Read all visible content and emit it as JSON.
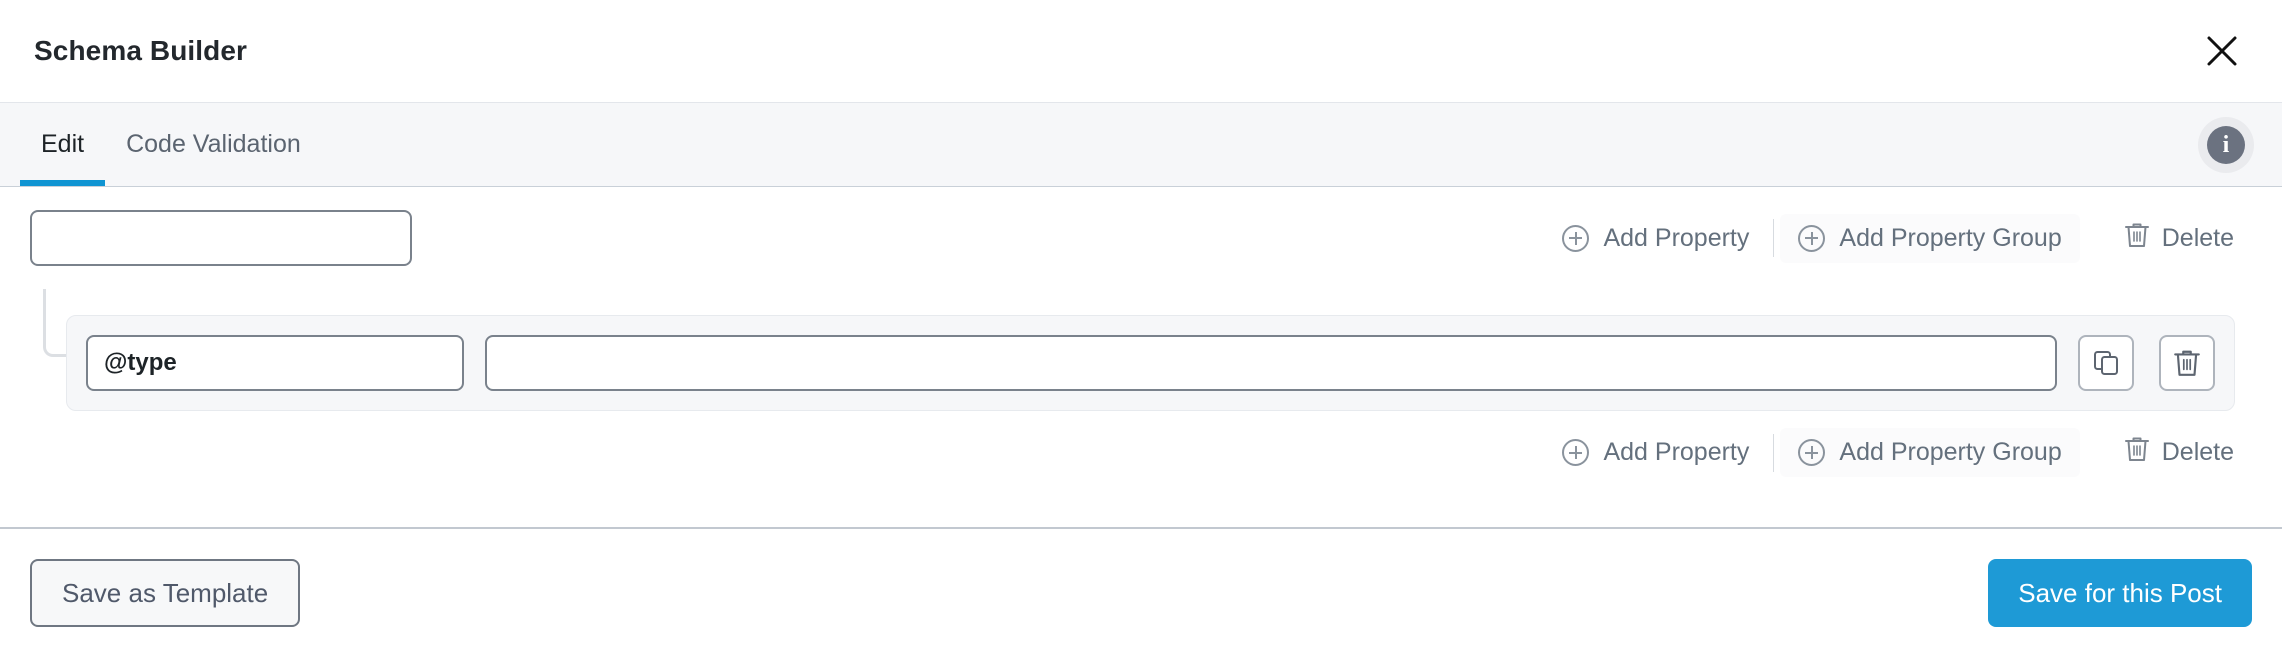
{
  "header": {
    "title": "Schema Builder",
    "close_icon": "close-icon"
  },
  "tabs": {
    "items": [
      {
        "label": "Edit",
        "active": true
      },
      {
        "label": "Code Validation",
        "active": false
      }
    ],
    "info_icon_label": "i"
  },
  "builder": {
    "root": {
      "input_value": "",
      "input_placeholder": ""
    },
    "actions_top": {
      "add_property_label": "Add Property",
      "add_property_group_label": "Add Property Group",
      "delete_label": "Delete",
      "add_icon": "plus-circle-icon",
      "delete_icon": "trash-icon"
    },
    "property_group": {
      "key_value": "@type",
      "key_placeholder": "",
      "value_value": "",
      "value_placeholder": "",
      "duplicate_icon": "copy-icon",
      "remove_icon": "trash-icon"
    },
    "actions_bottom": {
      "add_property_label": "Add Property",
      "add_property_group_label": "Add Property Group",
      "delete_label": "Delete",
      "add_icon": "plus-circle-icon",
      "delete_icon": "trash-icon"
    }
  },
  "footer": {
    "save_template_label": "Save as Template",
    "save_post_label": "Save for this Post"
  },
  "colors": {
    "accent": "#1e9ad6",
    "tab_underline": "#0f94d2",
    "text_primary": "#1d2327",
    "text_muted": "#64707d",
    "panel_bg": "#f6f7f9",
    "border": "#7a828c"
  }
}
